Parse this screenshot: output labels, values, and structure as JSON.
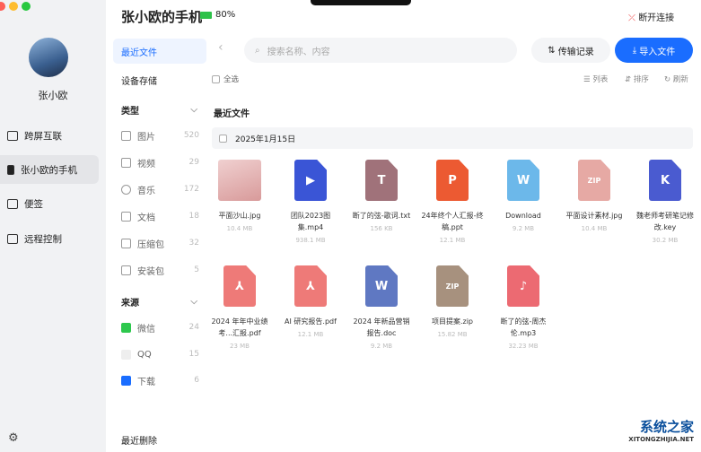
{
  "window": {
    "title": "张小欧的手机",
    "battery": "80%",
    "disconnect": "断开连接"
  },
  "user": {
    "name": "张小欧"
  },
  "sidebar": {
    "items": [
      {
        "label": "跨屏互联"
      },
      {
        "label": "张小欧的手机"
      },
      {
        "label": "便签"
      },
      {
        "label": "远程控制"
      }
    ]
  },
  "nav": {
    "recent": "最近文件",
    "storage": "设备存储",
    "type_header": "类型",
    "types": [
      {
        "label": "图片",
        "count": "520"
      },
      {
        "label": "视频",
        "count": "29"
      },
      {
        "label": "音乐",
        "count": "172"
      },
      {
        "label": "文档",
        "count": "18"
      },
      {
        "label": "压缩包",
        "count": "32"
      },
      {
        "label": "安装包",
        "count": "5"
      }
    ],
    "source_header": "来源",
    "sources": [
      {
        "label": "微信",
        "count": "24"
      },
      {
        "label": "QQ",
        "count": "15"
      },
      {
        "label": "下载",
        "count": "6"
      }
    ],
    "deleted": "最近删除"
  },
  "toolbar": {
    "search_placeholder": "搜索名称、内容",
    "transfer": "传输记录",
    "import": "导入文件",
    "select_all": "全选",
    "list": "列表",
    "sort": "排序",
    "refresh": "刷新"
  },
  "section": {
    "title": "最近文件",
    "date": "2025年1月15日"
  },
  "files": [
    {
      "name": "平面沙山.jpg",
      "size": "10.4 MB",
      "kind": "img",
      "color": "#e8b5b5"
    },
    {
      "name": "团队2023图集.mp4",
      "size": "938.1 MB",
      "kind": "▶",
      "color": "#3a55d6"
    },
    {
      "name": "断了的弦-歌词.txt",
      "size": "156 KB",
      "kind": "T",
      "color": "#a0727a"
    },
    {
      "name": "24年终个人汇报-终稿.ppt",
      "size": "12.1 MB",
      "kind": "P",
      "color": "#ec5a32"
    },
    {
      "name": "Download",
      "size": "9.2 MB",
      "kind": "W",
      "color": "#6cb8ea"
    },
    {
      "name": "平面设计素材.jpg",
      "size": "10.4 MB",
      "kind": "ZIP",
      "color": "#e6a9a4"
    },
    {
      "name": "魏老师考研笔记修改.key",
      "size": "30.2 MB",
      "kind": "K",
      "color": "#4a5bd0"
    },
    {
      "name": "2024 年年中业绩考...汇报.pdf",
      "size": "23 MB",
      "kind": "⅄",
      "color": "#ee7a78"
    },
    {
      "name": "AI 研究报告.pdf",
      "size": "12.1 MB",
      "kind": "⅄",
      "color": "#ee7a78"
    },
    {
      "name": "2024 年新品营销报告.doc",
      "size": "9.2 MB",
      "kind": "W",
      "color": "#5f78c2"
    },
    {
      "name": "项目提案.zip",
      "size": "15.82 MB",
      "kind": "ZIP",
      "color": "#a7917e"
    },
    {
      "name": "断了的弦-周杰伦.mp3",
      "size": "32.23 MB",
      "kind": "♪",
      "color": "#ec6a72"
    }
  ],
  "watermark": {
    "name": "系统之家",
    "url": "XITONGZHIJIA.NET"
  }
}
